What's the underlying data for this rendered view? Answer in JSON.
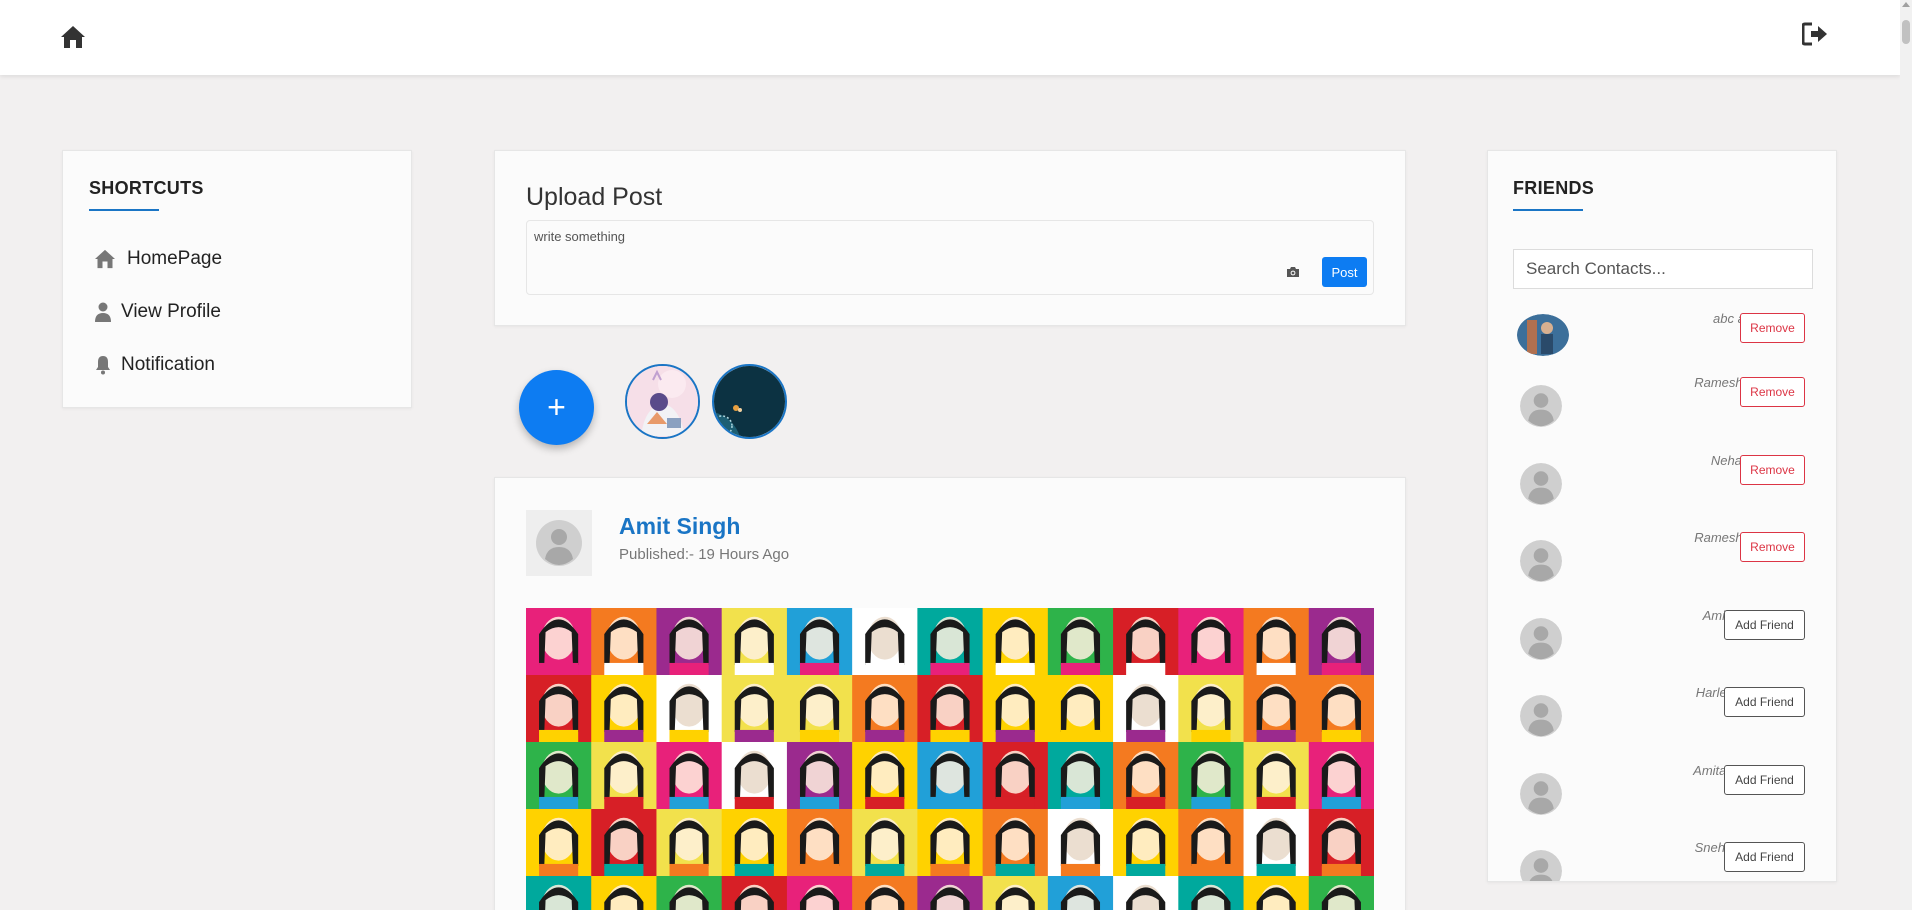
{
  "header": {
    "home_icon": "home-icon",
    "logout_icon": "logout-icon"
  },
  "shortcuts": {
    "title": "SHORTCUTS",
    "items": [
      {
        "label": "HomePage",
        "icon": "home-icon"
      },
      {
        "label": "View Profile",
        "icon": "user-icon"
      },
      {
        "label": "Notification",
        "icon": "bell-icon"
      }
    ]
  },
  "upload": {
    "title": "Upload Post",
    "placeholder": "write something",
    "camera_icon": "camera-icon",
    "post_label": "Post"
  },
  "stories": {
    "add_label": "+"
  },
  "feed": {
    "post": {
      "author": "Amit Singh",
      "published": "Published:- 19 Hours Ago"
    }
  },
  "friends": {
    "title": "FRIENDS",
    "search_placeholder": "Search Contacts...",
    "list": [
      {
        "name": "abc admin",
        "action": "Remove"
      },
      {
        "name": "Ramesh Sharma",
        "action": "Remove"
      },
      {
        "name": "Neha Patel",
        "action": "Remove"
      },
      {
        "name": "Ramesh Sharma",
        "action": "Remove"
      },
      {
        "name": "Amit Singh",
        "action": "Add Friend"
      },
      {
        "name": "Harleen Kaur",
        "action": "Add Friend"
      },
      {
        "name": "Amitabh Joshi",
        "action": "Add Friend"
      },
      {
        "name": "Sneha Reddy",
        "action": "Add Friend"
      }
    ]
  },
  "colors": {
    "accent": "#1a75c5",
    "primary_button": "#0d7cf2",
    "danger": "#dc3545",
    "background": "#f2f0f0"
  }
}
